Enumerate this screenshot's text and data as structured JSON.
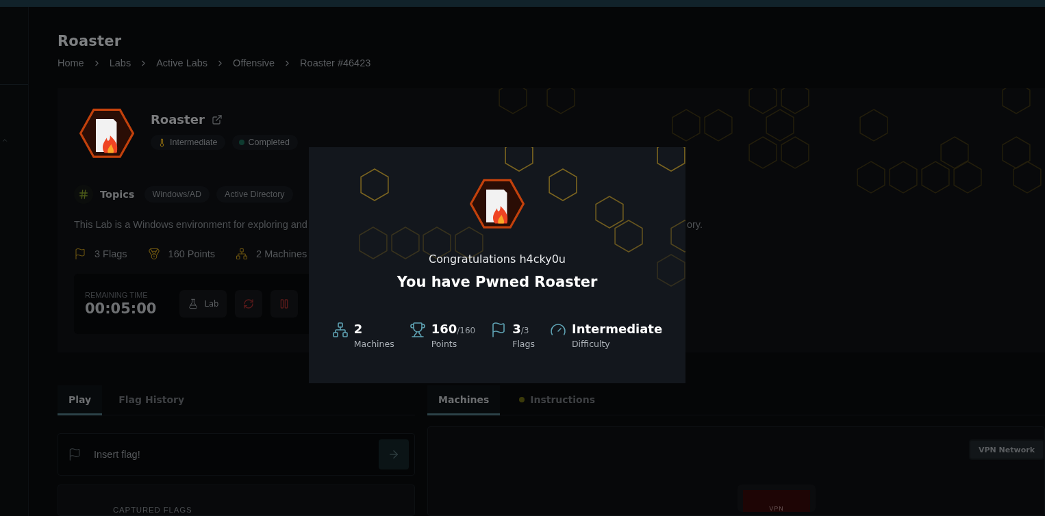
{
  "page": {
    "title": "Roaster",
    "breadcrumbs": [
      "Home",
      "Labs",
      "Active Labs",
      "Offensive",
      "Roaster #46423"
    ]
  },
  "lab": {
    "name": "Roaster",
    "badges": [
      {
        "kind": "difficulty",
        "label": "Intermediate"
      },
      {
        "kind": "status",
        "label": "Completed"
      }
    ],
    "topics_label": "Topics",
    "topics": [
      "Windows/AD",
      "Active Directory"
    ],
    "description_start": "This Lab is a Windows environment for exploring and",
    "description_end": "ory.",
    "stats": [
      {
        "kind": "flags",
        "label": "3 Flags"
      },
      {
        "kind": "points",
        "label": "160 Points"
      },
      {
        "kind": "machines",
        "label": "2 Machines"
      }
    ],
    "timer": {
      "label": "REMAINING TIME",
      "value": "00:05:00"
    },
    "controls": [
      {
        "kind": "lab",
        "label": "Lab"
      },
      {
        "kind": "reset"
      },
      {
        "kind": "pause"
      }
    ]
  },
  "left_tabs": [
    {
      "label": "Play",
      "selected": true
    },
    {
      "label": "Flag History",
      "selected": false
    }
  ],
  "flag_input": {
    "placeholder": "Insert flag!"
  },
  "captured_flags": {
    "label": "CAPTURED FLAGS"
  },
  "right_tabs": [
    {
      "label": "Machines",
      "selected": true
    },
    {
      "label": "Instructions",
      "selected": false
    }
  ],
  "network": {
    "button": "VPN Network",
    "node": "VPN"
  },
  "modal": {
    "greeting": "Congratulations h4cky0u",
    "title": "You have Pwned Roaster",
    "stats": [
      {
        "kind": "machines",
        "value": "2",
        "label": "Machines"
      },
      {
        "kind": "points",
        "value": "160",
        "total": "/160",
        "label": "Points"
      },
      {
        "kind": "flags",
        "value": "3",
        "total": "/3",
        "label": "Flags"
      },
      {
        "kind": "difficulty",
        "value": "Intermediate",
        "label": "Difficulty"
      }
    ]
  }
}
